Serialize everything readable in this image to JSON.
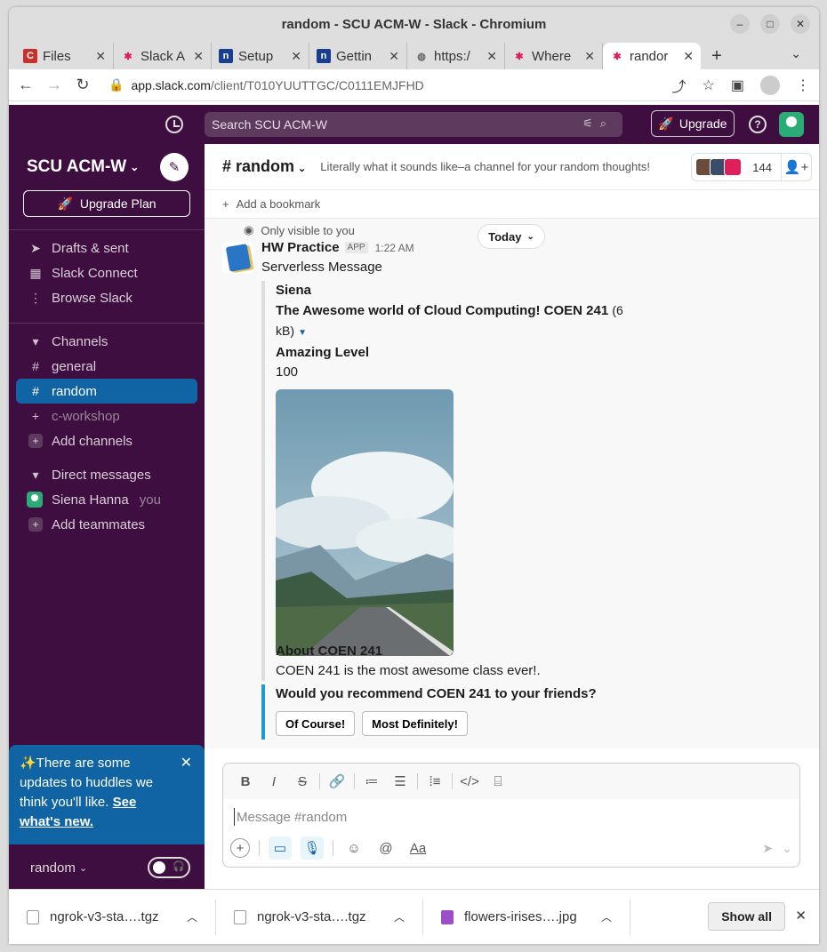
{
  "window": {
    "title": "random - SCU ACM-W - Slack - Chromium"
  },
  "tabs": [
    {
      "label": "Files",
      "fav_bg": "#c9302c",
      "fav_text": "C"
    },
    {
      "label": "Slack A",
      "fav_bg": "#ffffff",
      "fav_text": "✱"
    },
    {
      "label": "Setup",
      "fav_bg": "#1a3d8f",
      "fav_text": "n"
    },
    {
      "label": "Gettin",
      "fav_bg": "#1a3d8f",
      "fav_text": "n"
    },
    {
      "label": "https:/",
      "fav_bg": "#666666",
      "fav_text": "◍"
    },
    {
      "label": "Where",
      "fav_bg": "#ffffff",
      "fav_text": "✱"
    },
    {
      "label": "randor",
      "fav_bg": "#ffffff",
      "fav_text": "✱"
    }
  ],
  "address": {
    "host": "app.slack.com",
    "path": "/client/T010YUUTTGC/C0111EMJFHD"
  },
  "topbar": {
    "search_placeholder": "Search SCU ACM-W",
    "upgrade_label": "Upgrade"
  },
  "sidebar": {
    "workspace": "SCU ACM-W",
    "upgrade_plan": "Upgrade Plan",
    "nav": [
      {
        "label": "Drafts & sent",
        "icon": "send-icon"
      },
      {
        "label": "Slack Connect",
        "icon": "building-icon"
      },
      {
        "label": "Browse Slack",
        "icon": "more-icon"
      }
    ],
    "channels_header": "Channels",
    "channels": [
      {
        "label": "general"
      },
      {
        "label": "random"
      },
      {
        "label": "c-workshop"
      }
    ],
    "add_channels": "Add channels",
    "dm_header": "Direct messages",
    "dm_user": "Siena Hanna",
    "dm_you": "you",
    "add_teammates": "Add teammates",
    "huddle_text": "✨There are some updates to huddles we think you'll like.",
    "huddle_link": "See what's new.",
    "footer_channel": "random"
  },
  "channel": {
    "name": "random",
    "topic": "Literally what it sounds like–a channel for your random thoughts!",
    "member_count": "144",
    "bookmark": "Add a bookmark"
  },
  "message": {
    "only_visible": "Only visible to you",
    "date_divider": "Today",
    "sender": "HW Practice",
    "app_badge": "APP",
    "time": "1:22 AM",
    "text": "Serverless Message",
    "att_title": "Siena",
    "file_name": "The Awesome world of Cloud Computing! COEN 241",
    "file_size": "(6 kB)",
    "level_label": "Amazing Level",
    "level_value": "100",
    "about_title": "About COEN 241",
    "about_text": "COEN 241 is the most awesome class ever!.",
    "question": "Would you recommend COEN 241 to your friends?",
    "btn1": "Of Course!",
    "btn2": "Most Definitely!"
  },
  "composer": {
    "placeholder": "Message #random"
  },
  "downloads": [
    {
      "label": "ngrok-v3-sta….tgz",
      "kind": "file"
    },
    {
      "label": "ngrok-v3-sta….tgz",
      "kind": "file"
    },
    {
      "label": "flowers-irises….jpg",
      "kind": "image"
    }
  ],
  "downloads_show_all": "Show all",
  "colors": {
    "aubergine": "#3f0e40",
    "active_blue": "#1164a3",
    "accent_blue": "#1d9bd1"
  }
}
